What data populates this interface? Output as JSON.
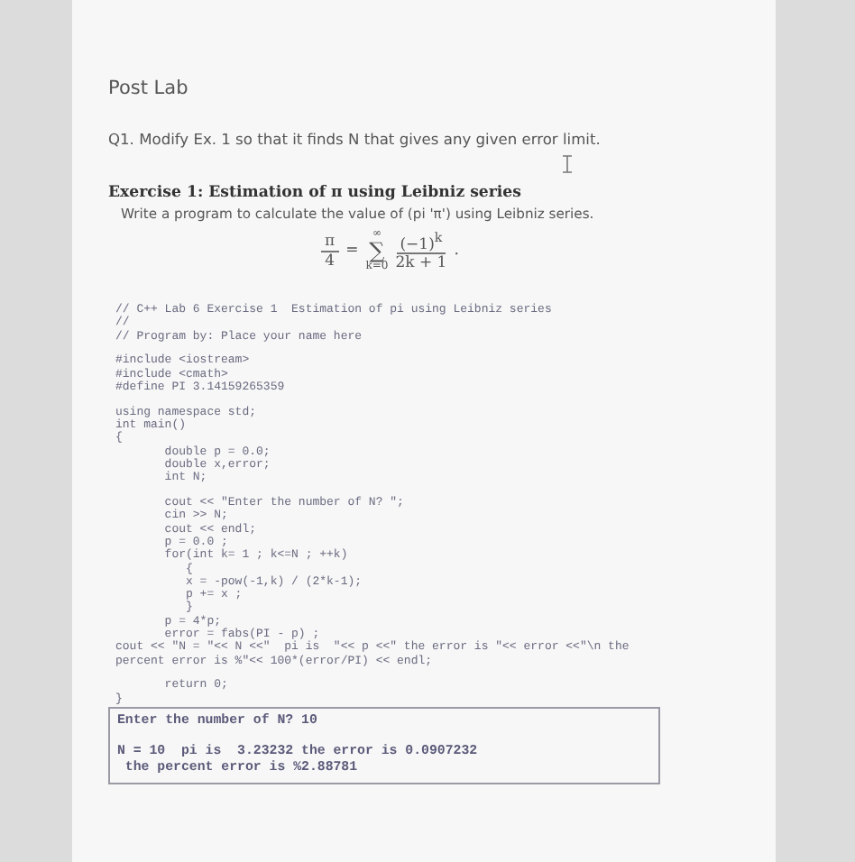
{
  "heading": "Post Lab",
  "question": "Q1. Modify Ex. 1 so that it finds N that gives any given error limit.",
  "exercise": {
    "title": "Exercise 1:  Estimation of π using Leibniz series",
    "description": "Write a program to calculate the value of (pi 'π') using Leibniz series.",
    "formula": {
      "lhs_numerator": "π",
      "lhs_denominator": "4",
      "equals": "=",
      "sum_upper": "∞",
      "sum_sign": "∑",
      "sum_lower": "k=0",
      "numerator": "(−1)$^{k}$",
      "denominator": "2k + 1",
      "end": "."
    }
  },
  "code_paragraphs": [
    [
      "// C++ Lab 6 Exercise 1  Estimation of pi using Leibniz series",
      "//",
      "// Program by: Place your name here"
    ],
    [
      "#include <iostream>",
      "#include <cmath>",
      "#define PI 3.14159265359"
    ],
    [
      "using namespace std;",
      "int main()",
      "{",
      "       double p = 0.0;",
      "       double x,error;",
      "       int N;"
    ],
    [
      "       cout << \"Enter the number of N? \";",
      "       cin >> N;",
      "       cout << endl;",
      "       p = 0.0 ;",
      "       for(int k= 1 ; k<=N ; ++k)",
      "          {",
      "          x = -pow(-1,k) / (2*k-1);",
      "          p += x ;",
      "          }",
      "       p = 4*p;",
      "       error = fabs(PI - p) ;",
      "cout << \"N = \"<< N <<\"  pi is  \"<< p <<\" the error is \"<< error <<\"\\n the",
      "percent error is %\"<< 100*(error/PI) << endl;"
    ],
    [
      "       return 0;",
      "}"
    ]
  ],
  "output_paragraphs": [
    [
      "Enter the number of N? 10"
    ],
    [
      "N = 10  pi is  3.23232 the error is 0.0907232",
      " the percent error is %2.88781"
    ]
  ]
}
